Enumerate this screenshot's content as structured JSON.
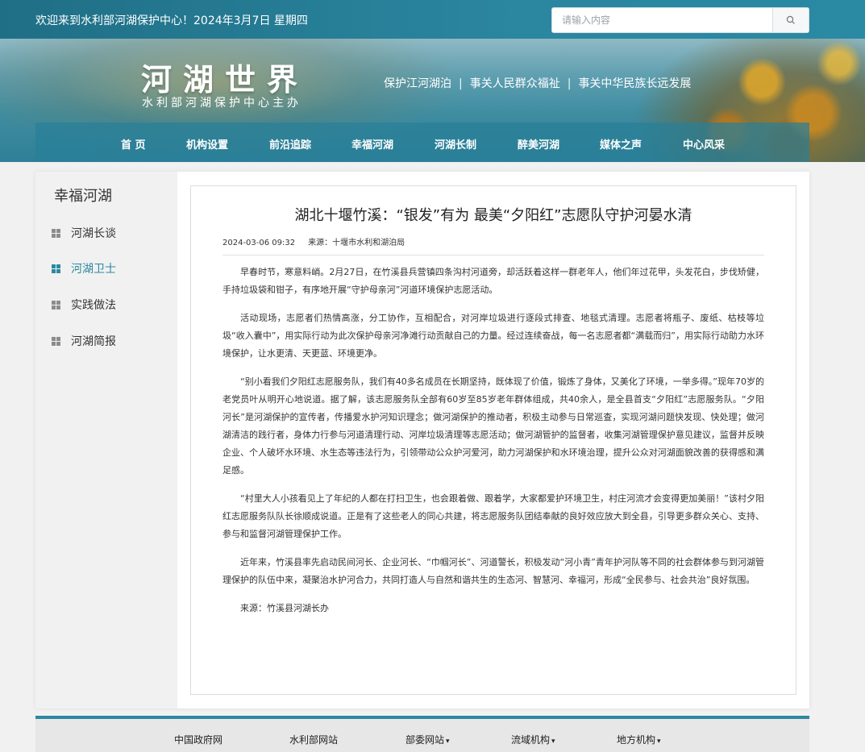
{
  "topbar": {
    "welcome": "欢迎来到水利部河湖保护中心！2024年3月7日 星期四",
    "search_placeholder": "请输入内容",
    "search_icon": "search-icon"
  },
  "banner": {
    "title": "河湖世界",
    "subtitle": "水利部河湖保护中心主办",
    "slogans": [
      "保护江河湖泊",
      "事关人民群众福祉",
      "事关中华民族长远发展"
    ],
    "slogan_separator": "|"
  },
  "nav": {
    "items": [
      "首 页",
      "机构设置",
      "前沿追踪",
      "幸福河湖",
      "河湖长制",
      "醉美河湖",
      "媒体之声",
      "中心风采"
    ]
  },
  "sidebar": {
    "title": "幸福河湖",
    "items": [
      {
        "label": "河湖长谈",
        "icon": "grid-icon"
      },
      {
        "label": "河湖卫士",
        "icon": "grid-icon",
        "active": true
      },
      {
        "label": "实践做法",
        "icon": "grid-icon"
      },
      {
        "label": "河湖简报",
        "icon": "grid-icon"
      }
    ]
  },
  "article": {
    "title": "湖北十堰竹溪：“银发”有为 最美“夕阳红”志愿队守护河晏水清",
    "date": "2024-03-06 09:32",
    "source_label": "来源：十堰市水利和湖泊局",
    "paragraphs": [
      "早春时节，寒意料峭。2月27日，在竹溪县兵营镇四条沟村河道旁，却活跃着这样一群老年人，他们年过花甲，头发花白，步伐矫健，手持垃圾袋和钳子，有序地开展“守护母亲河”河道环境保护志愿活动。",
      "活动现场，志愿者们热情高涨，分工协作，互相配合，对河岸垃圾进行逐段式排查、地毯式清理。志愿者将瓶子、废纸、枯枝等垃圾“收入囊中”，用实际行动为此次保护母亲河净滩行动贡献自己的力量。经过连续奋战，每一名志愿者都“满载而归”，用实际行动助力水环境保护，让水更清、天更蓝、环境更净。",
      "“别小看我们夕阳红志愿服务队，我们有40多名成员在长期坚持，既体现了价值，锻炼了身体，又美化了环境，一举多得。”现年70岁的老党员叶从明开心地说道。据了解，该志愿服务队全部有60岁至85岁老年群体组成，共40余人，是全县首支“夕阳红”志愿服务队。“夕阳河长”是河湖保护的宣传者，传播爱水护河知识理念；做河湖保护的推动者，积极主动参与日常巡查，实现河湖问题快发现、快处理；做河湖清洁的践行者，身体力行参与河道清理行动、河岸垃圾清理等志愿活动；做河湖管护的监督者，收集河湖管理保护意见建议，监督并反映企业、个人破坏水环境、水生态等违法行为，引领带动公众护河爱河，助力河湖保护和水环境治理，提升公众对河湖面貌改善的获得感和满足感。",
      "“村里大人小孩看见上了年纪的人都在打扫卫生，也会跟着做、跟着学，大家都爱护环境卫生，村庄河流才会变得更加美丽！”该村夕阳红志愿服务队队长徐顺成说道。正是有了这些老人的同心共建，将志愿服务队团结奉献的良好效应放大到全县，引导更多群众关心、支持、参与和监督河湖管理保护工作。",
      "近年来，竹溪县率先启动民间河长、企业河长、“巾帼河长”、河道警长，积极发动“河小青”青年护河队等不同的社会群体参与到河湖管理保护的队伍中来，凝聚治水护河合力，共同打造人与自然和谐共生的生态河、智慧河、幸福河，形成“全民参与、社会共治”良好氛围。",
      "来源：竹溪县河湖长办"
    ]
  },
  "footer": {
    "links": [
      {
        "label": "中国政府网",
        "dropdown": false
      },
      {
        "label": "水利部网站",
        "dropdown": false
      },
      {
        "label": "部委网站",
        "dropdown": true
      },
      {
        "label": "流域机构",
        "dropdown": true
      },
      {
        "label": "地方机构",
        "dropdown": true
      }
    ],
    "caret": "▾"
  },
  "colors": {
    "brand": "#2c88a2",
    "topbar": "#2b86a0",
    "sidebar_bg": "#f1f1f1",
    "footer_bg": "#e7e7e7"
  }
}
